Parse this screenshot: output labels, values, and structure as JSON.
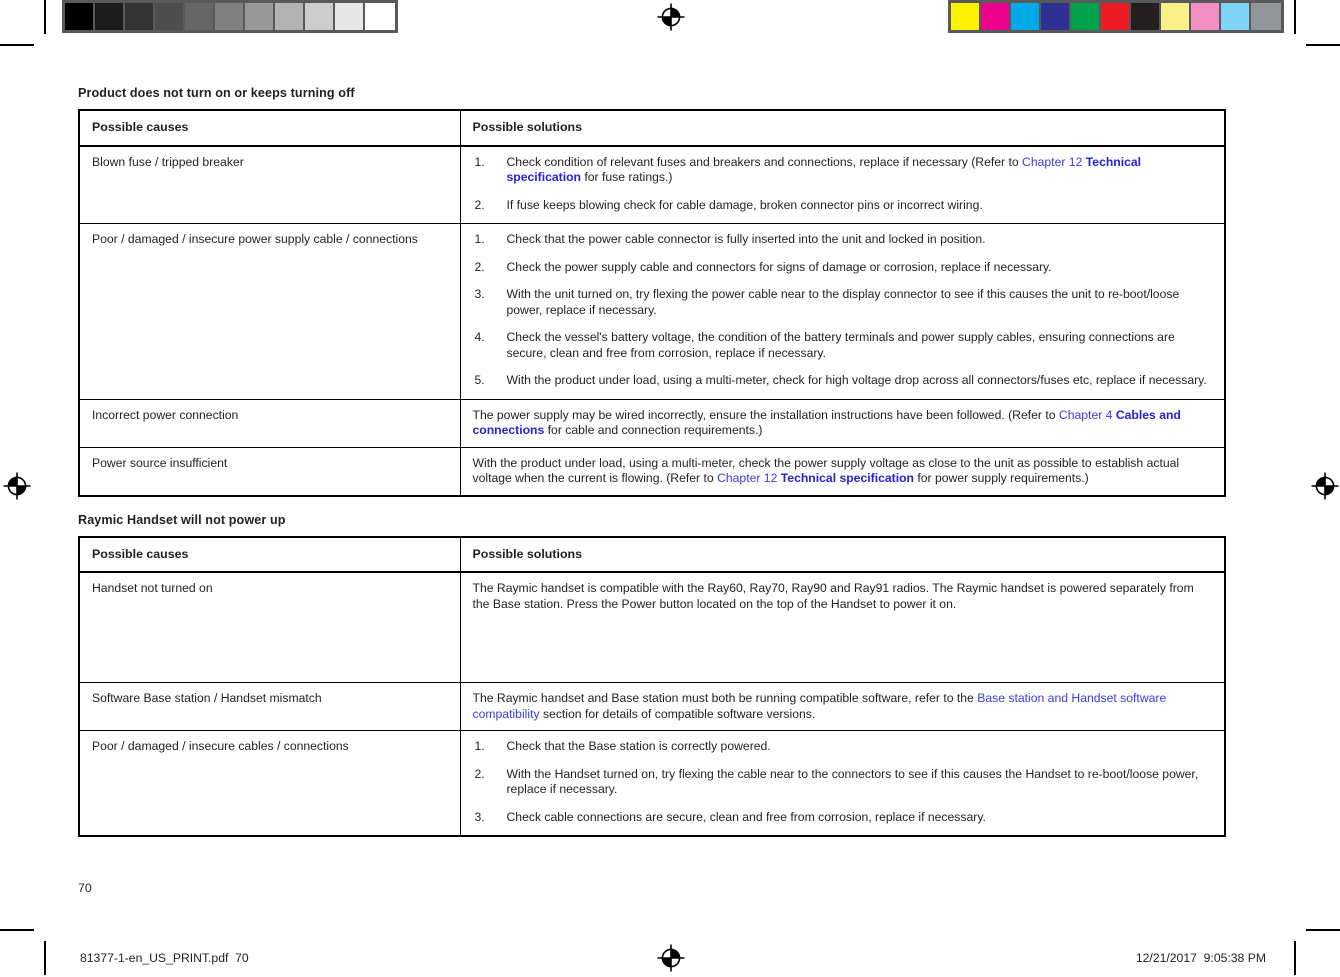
{
  "page": {
    "number": "70"
  },
  "calibration": {
    "gray_label": "grayscale-calibration-strip",
    "gray_swatches": [
      "#000000",
      "#1b1b1b",
      "#333333",
      "#4d4d4d",
      "#666666",
      "#808080",
      "#999999",
      "#b3b3b3",
      "#cccccc",
      "#e6e6e6",
      "#ffffff"
    ],
    "color_label": "color-calibration-strip",
    "color_swatches": [
      "#fff200",
      "#ec008c",
      "#00a9e8",
      "#2e3192",
      "#00a14b",
      "#ed1c24",
      "#231f20",
      "#fbf088",
      "#f48fc4",
      "#7fd4f5",
      "#939598"
    ]
  },
  "sections": [
    {
      "title": "Product does not turn on or keeps turning off",
      "headers": {
        "causes": "Possible causes",
        "solutions": "Possible solutions"
      },
      "rows": [
        {
          "cause": "Blown fuse / tripped breaker",
          "type": "list",
          "steps": [
            {
              "parts": [
                {
                  "t": "Check condition of relevant fuses and breakers and connections, replace if necessary (Refer to ",
                  "s": "plain"
                },
                {
                  "t": "Chapter 12",
                  "s": "link"
                },
                {
                  "t": " ",
                  "s": "plain"
                },
                {
                  "t": "Technical specification",
                  "s": "link-bold"
                },
                {
                  "t": " for fuse ratings.)",
                  "s": "plain"
                }
              ]
            },
            {
              "parts": [
                {
                  "t": "If fuse keeps blowing check for cable damage, broken connector pins or incorrect wiring.",
                  "s": "plain"
                }
              ]
            }
          ],
          "pad": ""
        },
        {
          "cause": "Poor / damaged / insecure power supply cable / connections",
          "type": "list",
          "steps": [
            {
              "parts": [
                {
                  "t": "Check that the power cable connector is fully inserted into the unit and locked in position.",
                  "s": "plain"
                }
              ]
            },
            {
              "parts": [
                {
                  "t": "Check the power supply cable and connectors for signs of damage or corrosion, replace if necessary.",
                  "s": "plain"
                }
              ]
            },
            {
              "parts": [
                {
                  "t": "With the unit turned on, try flexing the power cable near to the display connector to see if this causes the unit to re-boot/loose power, replace if necessary.",
                  "s": "plain"
                }
              ]
            },
            {
              "parts": [
                {
                  "t": "Check the vessel's battery voltage, the condition of the battery terminals and power supply cables, ensuring connections are secure, clean and free from corrosion, replace if necessary.",
                  "s": "plain"
                }
              ]
            },
            {
              "parts": [
                {
                  "t": "With the product under load, using a multi-meter, check for high voltage drop across all connectors/fuses etc, replace if necessary.",
                  "s": "plain"
                }
              ]
            }
          ],
          "pad": ""
        },
        {
          "cause": "Incorrect power connection",
          "type": "para",
          "parts": [
            {
              "t": "The power supply may be wired incorrectly, ensure the installation instructions have been followed. (Refer to ",
              "s": "plain"
            },
            {
              "t": "Chapter 4",
              "s": "link"
            },
            {
              "t": " ",
              "s": "plain"
            },
            {
              "t": "Cables and connections",
              "s": "link-bold"
            },
            {
              "t": " for cable and connection requirements.)",
              "s": "plain"
            }
          ],
          "pad": ""
        },
        {
          "cause": "Power source insufficient",
          "type": "para",
          "parts": [
            {
              "t": "With the product under load, using a multi-meter, check the power supply voltage as close to the unit as possible to establish actual voltage when the current is flowing. (Refer to ",
              "s": "plain"
            },
            {
              "t": "Chapter 12",
              "s": "link"
            },
            {
              "t": " ",
              "s": "plain"
            },
            {
              "t": "Technical specification",
              "s": "link-bold"
            },
            {
              "t": " for power supply requirements.)",
              "s": "plain"
            }
          ],
          "pad": ""
        }
      ]
    },
    {
      "title": "Raymic Handset will not power up",
      "headers": {
        "causes": "Possible causes",
        "solutions": "Possible solutions"
      },
      "rows": [
        {
          "cause": "Handset not turned on",
          "type": "para",
          "parts": [
            {
              "t": "The Raymic handset is compatible with the Ray60, Ray70, Ray90 and Ray91 radios. The Raymic handset is powered separately from the Base station. Press the Power button located on the top of the Handset to power it on.",
              "s": "plain"
            }
          ],
          "pad": "md"
        },
        {
          "cause": "Software Base station / Handset mismatch",
          "type": "para",
          "parts": [
            {
              "t": "The Raymic handset and Base station must both be running compatible software, refer to the ",
              "s": "plain"
            },
            {
              "t": "Base station and Handset software compatibility",
              "s": "link"
            },
            {
              "t": " section for details of compatible software versions.",
              "s": "plain"
            }
          ],
          "pad": ""
        },
        {
          "cause": "Poor / damaged / insecure cables / connections",
          "type": "list",
          "steps": [
            {
              "parts": [
                {
                  "t": "Check that the Base station is correctly powered.",
                  "s": "plain"
                }
              ]
            },
            {
              "parts": [
                {
                  "t": "With the Handset turned on, try flexing the cable near to the connectors to see if this causes the Handset to re-boot/loose power, replace if necessary.",
                  "s": "plain"
                }
              ]
            },
            {
              "parts": [
                {
                  "t": "Check cable connections are secure, clean and free from corrosion, replace if necessary.",
                  "s": "plain"
                }
              ]
            }
          ],
          "pad": ""
        }
      ]
    }
  ],
  "footer": {
    "file_label": "81377-1-en_US_PRINT.pdf",
    "file_page": "70",
    "date": "12/21/2017",
    "time": "9:05:38 PM"
  }
}
